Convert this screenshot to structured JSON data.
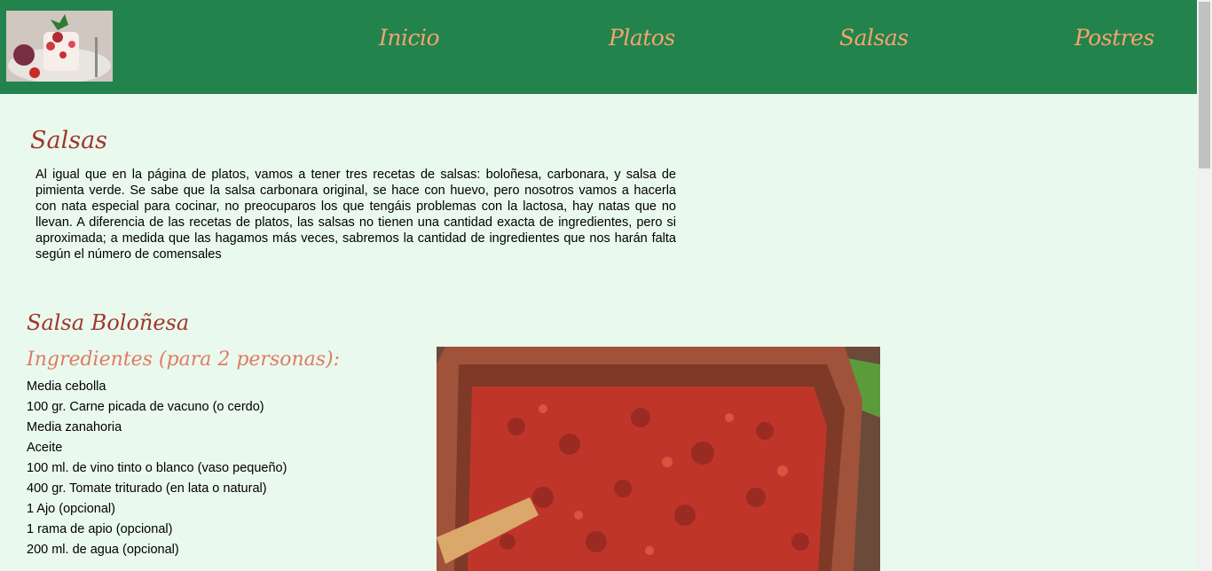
{
  "nav": {
    "items": [
      "Inicio",
      "Platos",
      "Salsas",
      "Postres"
    ]
  },
  "main": {
    "title": "Salsas",
    "intro": "Al igual que en la página de platos, vamos a tener tres recetas de salsas: boloñesa, carbonara, y salsa de pimienta verde. Se sabe que la salsa carbonara original, se hace con huevo, pero nosotros vamos a hacerla con nata especial para cocinar, no preocuparos los que tengáis problemas con la lactosa, hay natas que no llevan. A diferencia de las recetas de platos, las salsas no tienen una cantidad exacta de ingredientes, pero si aproximada; a medida que las hagamos más veces, sabremos la cantidad de ingredientes que nos harán falta según el número de comensales"
  },
  "recipe": {
    "title": "Salsa Boloñesa",
    "ingredients_title": "Ingredientes (para 2 personas):",
    "ingredients": [
      "Media cebolla",
      "100 gr. Carne picada de vacuno (o cerdo)",
      "Media zanahoria",
      "Aceite",
      "100 ml. de vino tinto o blanco (vaso pequeño)",
      "400 gr. Tomate triturado (en lata o natural)",
      "1 Ajo (opcional)",
      "1 rama de apio (opcional)",
      "200 ml. de agua (opcional)"
    ]
  },
  "colors": {
    "header": "#22834d",
    "nav_text": "#f4a46c",
    "page_bg": "#eaf9ee",
    "title": "#a0372d",
    "subtitle": "#e07b62"
  }
}
